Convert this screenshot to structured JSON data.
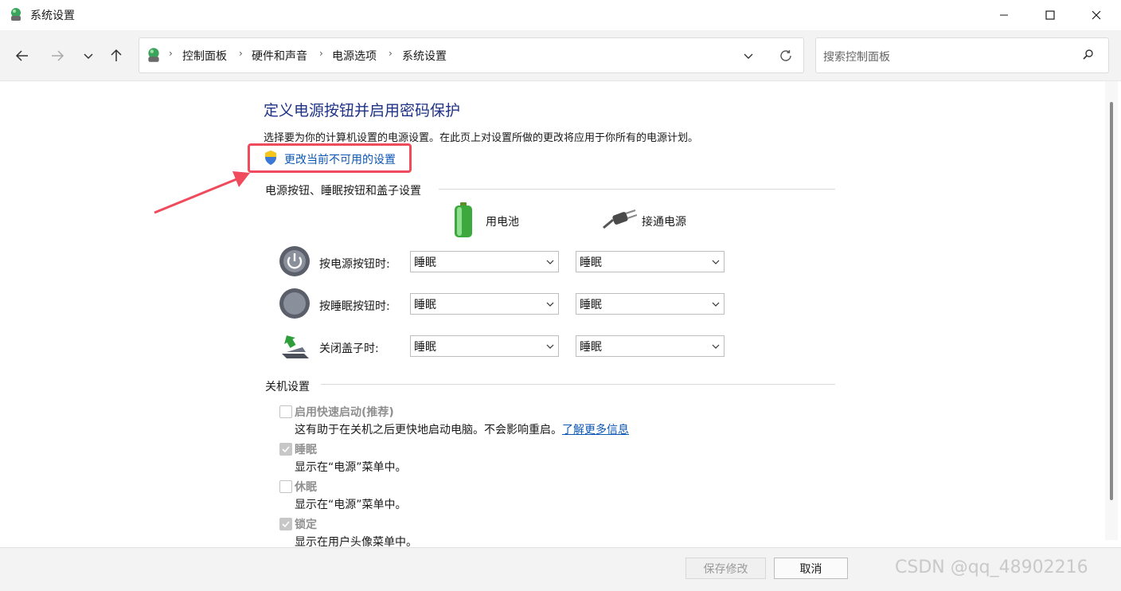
{
  "window": {
    "title": "系统设置"
  },
  "nav": {
    "breadcrumb": [
      "控制面板",
      "硬件和声音",
      "电源选项",
      "系统设置"
    ],
    "search_placeholder": "搜索控制面板"
  },
  "page": {
    "title": "定义电源按钮并启用密码保护",
    "description": "选择要为你的计算机设置的电源设置。在此页上对设置所做的更改将应用于你所有的电源计划。",
    "change_link": "更改当前不可用的设置"
  },
  "power_section": {
    "label": "电源按钮、睡眠按钮和盖子设置",
    "col_battery": "用电池",
    "col_plugged": "接通电源",
    "rows": [
      {
        "label": "按电源按钮时:",
        "battery": "睡眠",
        "plugged": "睡眠",
        "icon": "power-button-icon"
      },
      {
        "label": "按睡眠按钮时:",
        "battery": "睡眠",
        "plugged": "睡眠",
        "icon": "sleep-button-icon"
      },
      {
        "label": "关闭盖子时:",
        "battery": "睡眠",
        "plugged": "睡眠",
        "icon": "laptop-lid-icon"
      }
    ]
  },
  "shutdown_section": {
    "label": "关机设置",
    "options": [
      {
        "title": "启用快速启动(推荐)",
        "desc": "这有助于在关机之后更快地启动电脑。不会影响重启。",
        "link": "了解更多信息",
        "checked": false
      },
      {
        "title": "睡眠",
        "desc": "显示在“电源”菜单中。",
        "checked": true
      },
      {
        "title": "休眠",
        "desc": "显示在“电源”菜单中。",
        "checked": false
      },
      {
        "title": "锁定",
        "desc": "显示在用户头像菜单中。",
        "checked": true
      }
    ]
  },
  "footer": {
    "save_label": "保存修改",
    "cancel_label": "取消",
    "watermark": "CSDN @qq_48902216"
  },
  "colors": {
    "title_blue": "#1e3287",
    "link_blue": "#0d57b5",
    "highlight_red": "#f04a5d"
  }
}
